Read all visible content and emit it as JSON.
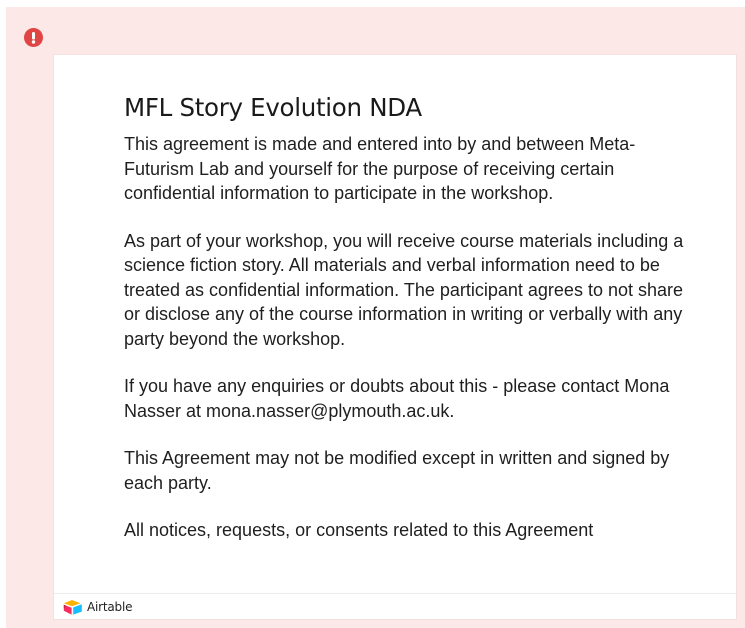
{
  "form": {
    "title": "MFL Story Evolution NDA",
    "paragraphs": [
      "This agreement is made and entered into by and between Meta-Futurism Lab and yourself for the purpose of receiving certain confidential information to participate in the workshop.",
      "As part of your workshop, you will receive course materials including a science fiction story. All materials and verbal information need to be treated as confidential information. The participant agrees to not share or disclose any of the course information in writing or verbally with any party beyond the workshop.",
      "If you have any enquiries or doubts about this - please contact Mona Nasser at mona.nasser@plymouth.ac.uk.",
      "This Agreement may not be modified except in written and signed by each party.",
      "All notices, requests, or consents related to this  Agreement"
    ]
  },
  "alert": {
    "icon": "alert-circle-icon",
    "color": "#e04545"
  },
  "footer": {
    "brand": "Airtable",
    "logo_icon": "airtable-logo-icon"
  },
  "colors": {
    "frame_background": "#fde8e8",
    "card_background": "#ffffff"
  }
}
